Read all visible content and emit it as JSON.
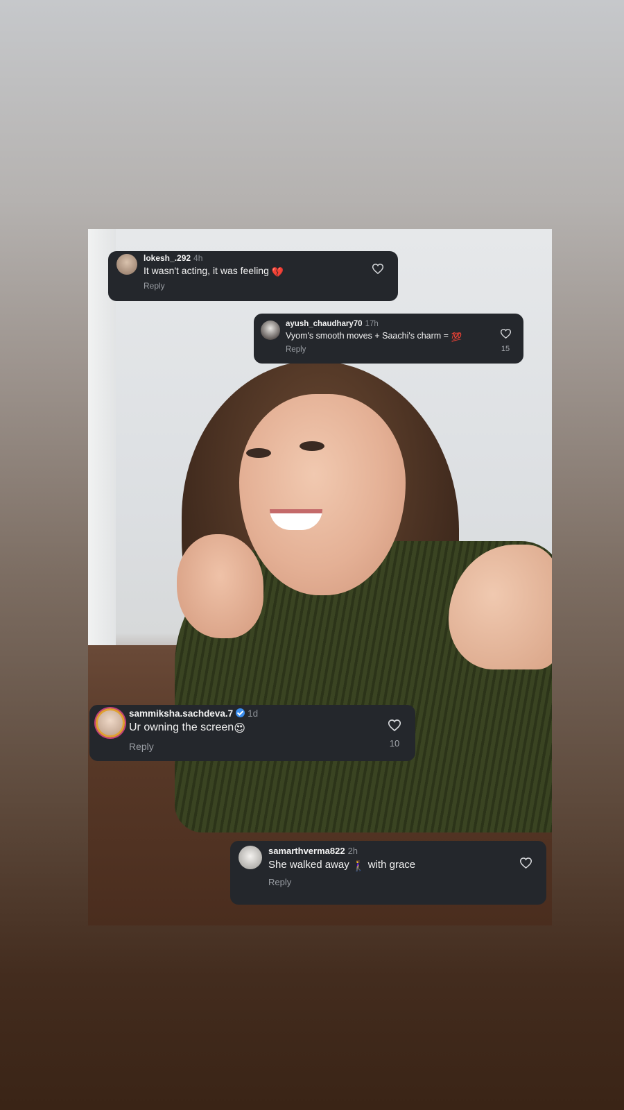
{
  "comments": [
    {
      "username": "lokesh_.292",
      "time": "4h",
      "text": "It wasn't acting, it was feeling",
      "emoji": "💔",
      "reply": "Reply",
      "likes": ""
    },
    {
      "username": "ayush_chaudhary70",
      "time": "17h",
      "text": "Vyom's smooth moves + Saachi's charm =",
      "emoji": "💯",
      "reply": "Reply",
      "likes": "15"
    },
    {
      "username": "sammiksha.sachdeva.7",
      "verified": true,
      "time": "1d",
      "text": "Ur owning the screen",
      "emoji": "😍",
      "reply": "Reply",
      "likes": "10"
    },
    {
      "username": "samarthverma822",
      "time": "2h",
      "text_before": "She walked away",
      "emoji": "🚶‍♀️",
      "text_after": "with grace",
      "reply": "Reply",
      "likes": ""
    }
  ],
  "colors": {
    "card_bg": "#24272c",
    "text": "#f3f3f3",
    "muted": "#9a9ea4",
    "verified": "#3b8ff0",
    "avatar_ring": "#e0a030"
  },
  "icons": [
    "heart-icon",
    "verified-icon"
  ]
}
